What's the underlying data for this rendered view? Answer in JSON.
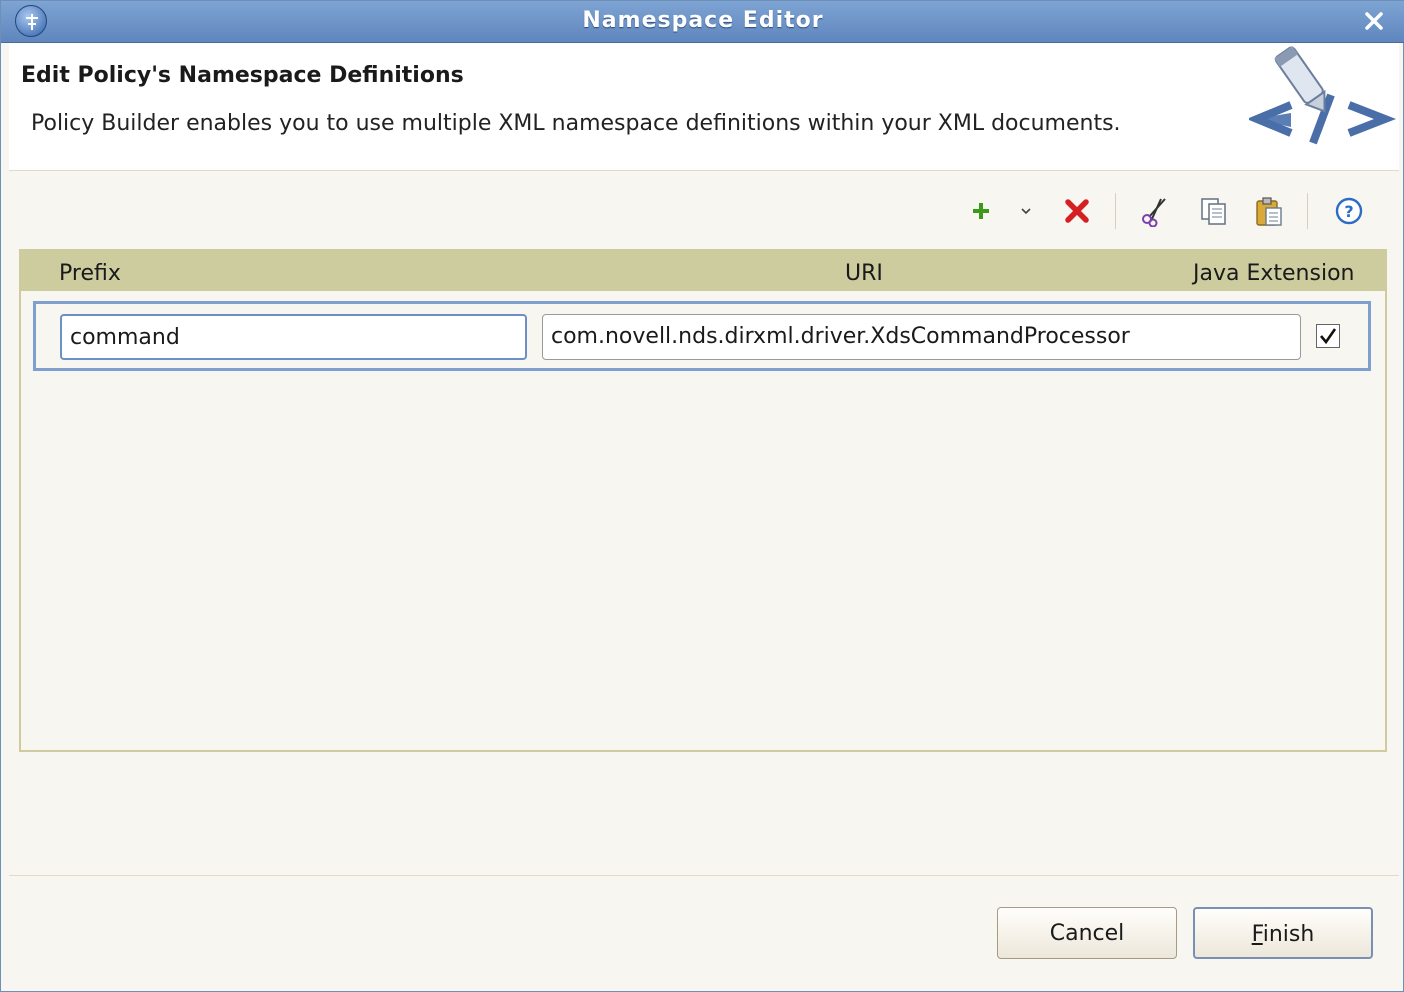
{
  "window": {
    "title": "Namespace Editor"
  },
  "header": {
    "heading": "Edit Policy's Namespace Definitions",
    "description": "Policy Builder enables you to use multiple XML namespace definitions within your XML documents."
  },
  "toolbar": {
    "items": [
      "add-icon",
      "dropdown-arrow-icon",
      "delete-icon",
      "cut-icon",
      "copy-icon",
      "paste-icon",
      "help-icon"
    ]
  },
  "table": {
    "columns": [
      "Prefix",
      "URI",
      "Java Extension"
    ],
    "rows": [
      {
        "prefix": "command",
        "uri": "com.novell.nds.dirxml.driver.XdsCommandProcessor",
        "java_extension": true
      }
    ]
  },
  "buttons": {
    "cancel": "Cancel",
    "finish_first": "F",
    "finish_rest": "inish"
  },
  "colors": {
    "titlebar": "#6c92c8",
    "table_header": "#cdcc9f",
    "selection_border": "#7fa0cf",
    "add_green": "#3c9a1a",
    "delete_red": "#d42020"
  }
}
